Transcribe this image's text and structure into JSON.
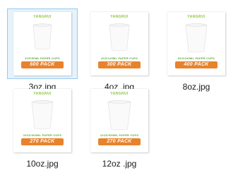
{
  "files": [
    {
      "name": "3oz.jpg",
      "brand": "YANGRUI",
      "cup_text": "3OZ/90ML PAPER CUPS",
      "pack": "600 PACK",
      "selected": true
    },
    {
      "name": "4oz .jpg",
      "brand": "YANGRUI",
      "cup_text": "4OZ/120ML PAPER CUPS",
      "pack": "300 PACK",
      "selected": false
    },
    {
      "name": "8oz.jpg",
      "brand": "YANGRUI",
      "cup_text": "8OZ/240ML PAPER CUPS",
      "pack": "400 PACK",
      "selected": false
    },
    {
      "name": "10oz.jpg",
      "brand": "YANGRUI",
      "cup_text": "10OZ/300ML PAPER CUPS",
      "pack": "270 PACK",
      "selected": false
    },
    {
      "name": "12oz .jpg",
      "brand": "YANGRUI",
      "cup_text": "12OZ/350ML PAPER CUPS",
      "pack": "270 PACK",
      "selected": false
    }
  ],
  "colors": {
    "brand": "#8cc63f",
    "pack_badge": "#e8832c",
    "selection_border": "#99c9ef",
    "selection_fill": "#e5f3fb"
  }
}
